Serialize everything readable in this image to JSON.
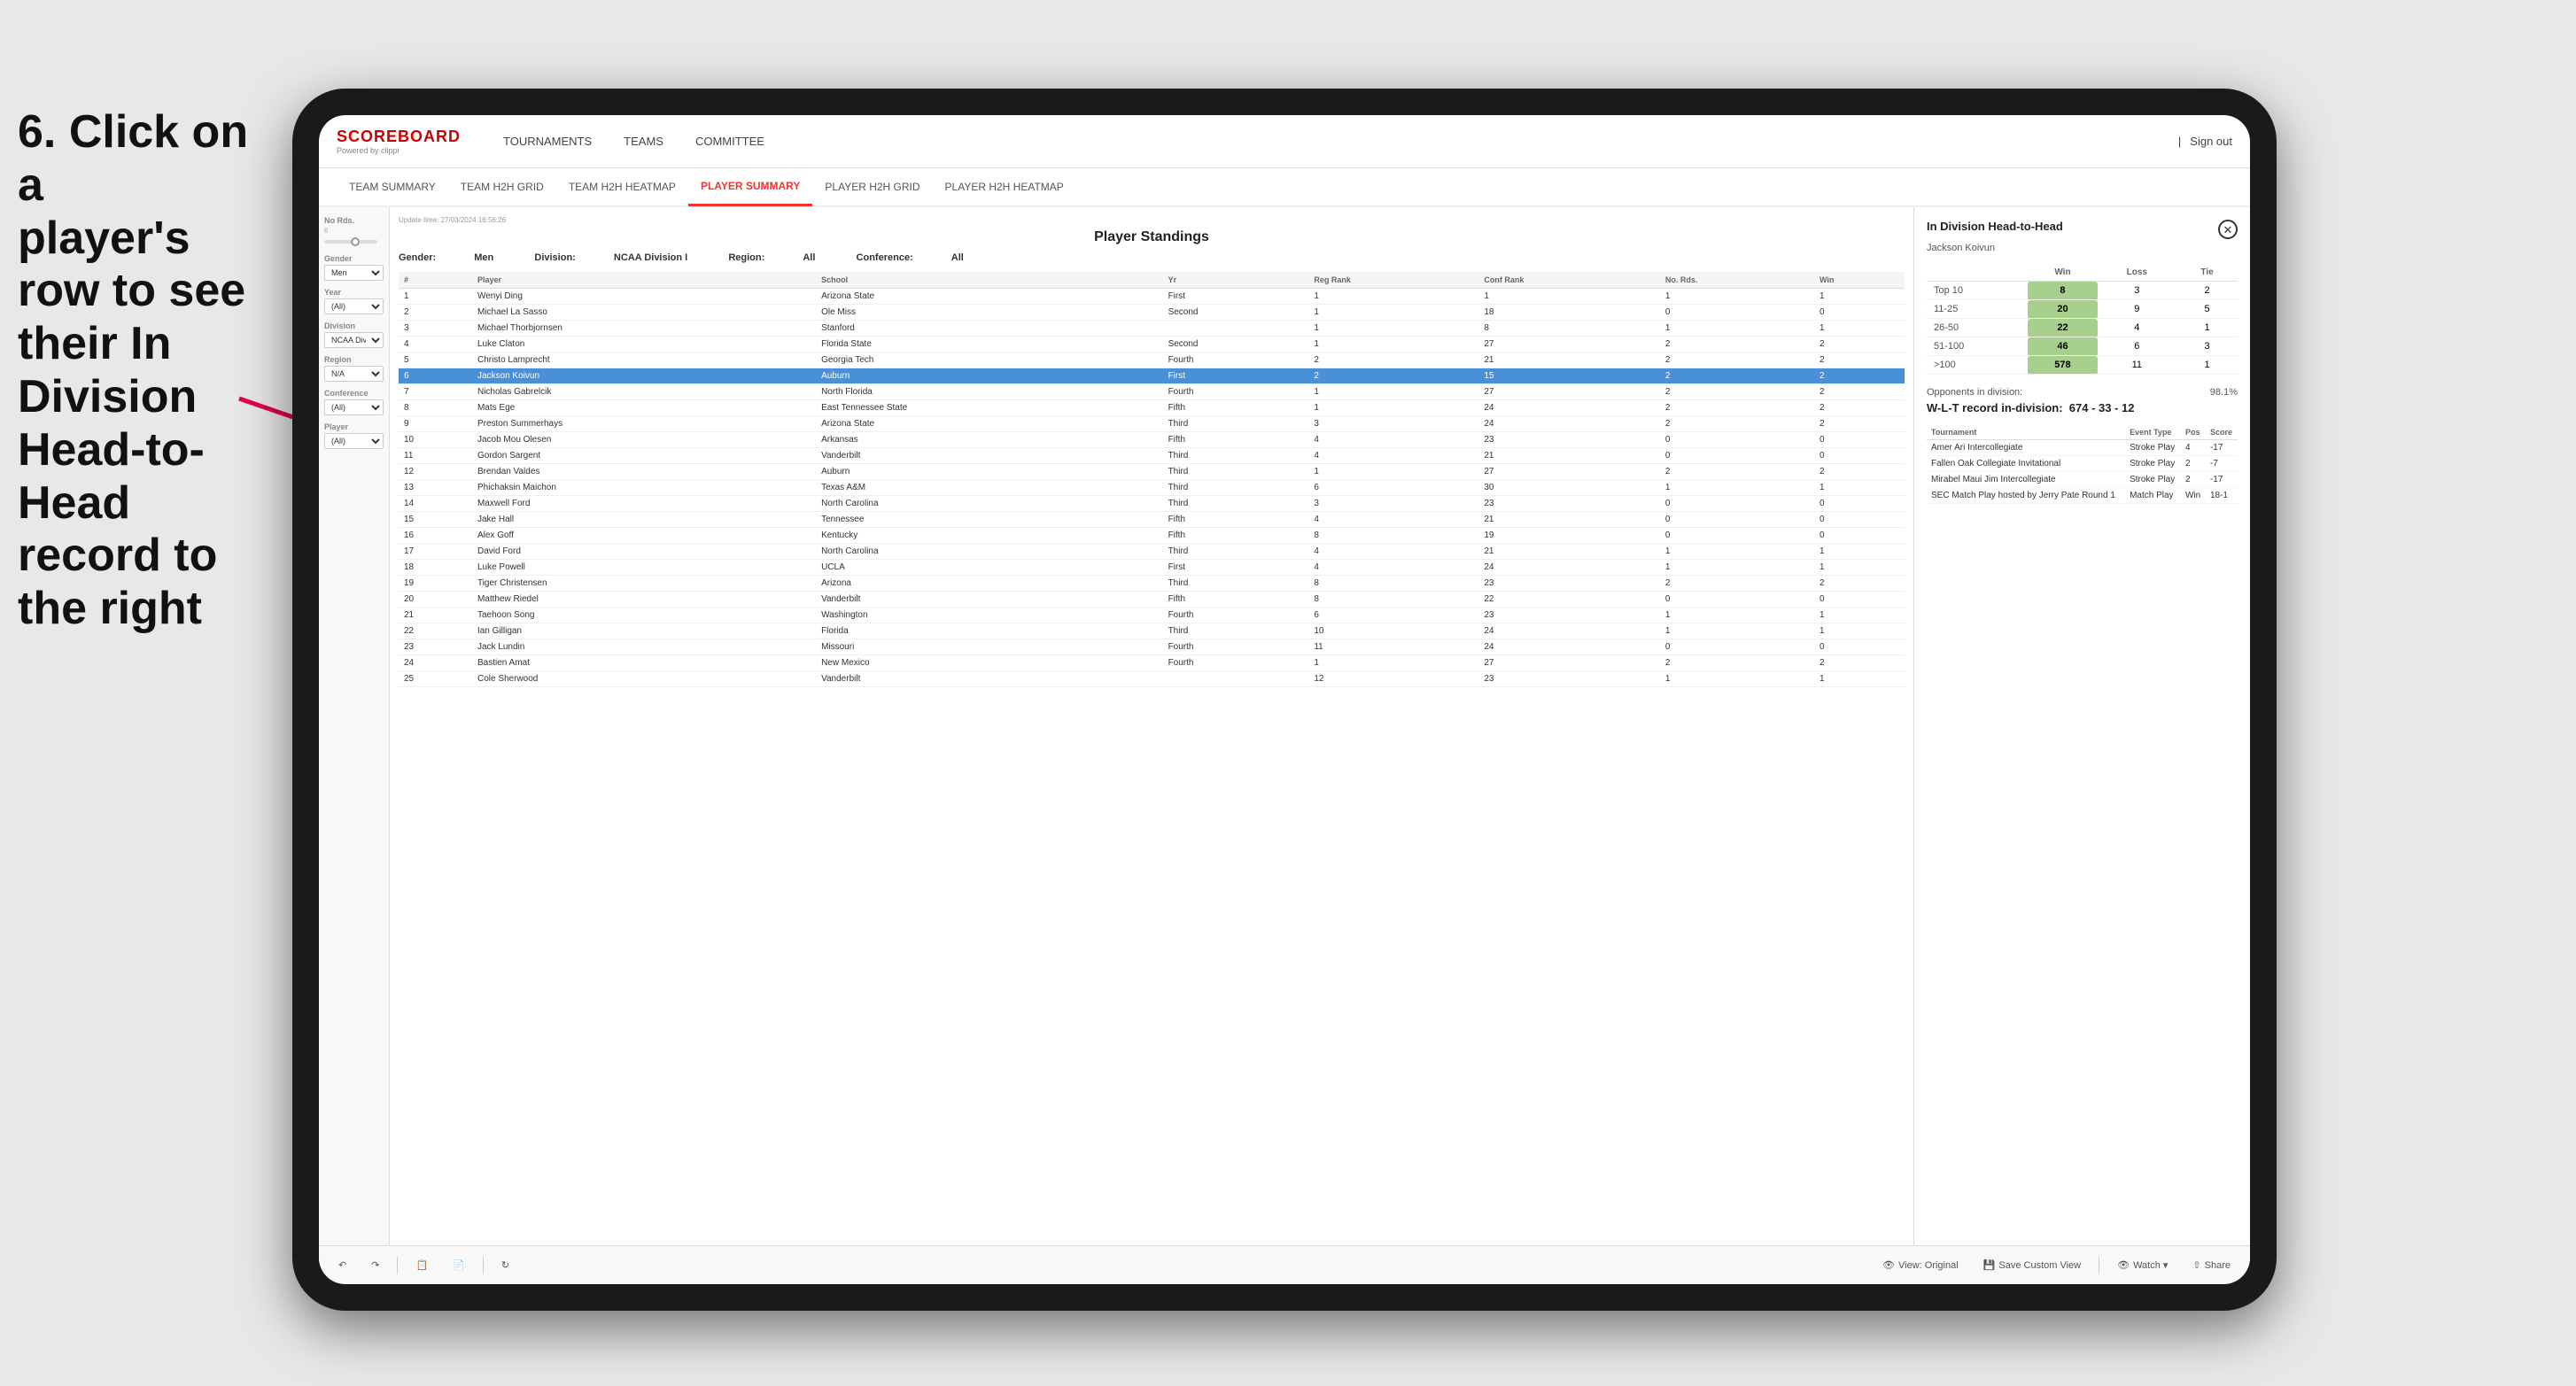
{
  "instruction": {
    "line1": "6. Click on a",
    "line2": "player's row to see",
    "line3": "their In Division",
    "line4": "Head-to-Head",
    "line5": "record to the right"
  },
  "nav": {
    "logo": "SCOREBOARD",
    "powered_by": "Powered by clippi",
    "items": [
      "TOURNAMENTS",
      "TEAMS",
      "COMMITTEE"
    ],
    "sign_out": "Sign out"
  },
  "sub_nav": {
    "items": [
      "TEAM SUMMARY",
      "TEAM H2H GRID",
      "TEAM H2H HEATMAP",
      "PLAYER SUMMARY",
      "PLAYER H2H GRID",
      "PLAYER H2H HEATMAP"
    ],
    "active": "PLAYER SUMMARY"
  },
  "filters": {
    "no_rds_label": "No Rds.",
    "no_rds_value": "6",
    "gender_label": "Gender",
    "gender_value": "Men",
    "year_label": "Year",
    "year_value": "(All)",
    "division_label": "Division",
    "division_value": "NCAA Division I",
    "region_label": "Region",
    "region_value": "N/A",
    "conference_label": "Conference",
    "conference_value": "(All)",
    "player_label": "Player",
    "player_value": "(All)"
  },
  "standings": {
    "title": "Player Standings",
    "update_time": "Update time: 27/03/2024 16:56:26",
    "gender_label": "Gender:",
    "gender_value": "Men",
    "division_label": "Division:",
    "division_value": "NCAA Division I",
    "region_label": "Region:",
    "region_value": "All",
    "conference_label": "Conference:",
    "conference_value": "All",
    "columns": [
      "#",
      "Player",
      "School",
      "Yr",
      "Reg Rank",
      "Conf Rank",
      "No. Rds.",
      "Win"
    ],
    "rows": [
      {
        "num": 1,
        "player": "Wenyi Ding",
        "school": "Arizona State",
        "yr": "First",
        "reg": 1,
        "conf": 1,
        "rds": 1,
        "win": 1
      },
      {
        "num": 2,
        "player": "Michael La Sasso",
        "school": "Ole Miss",
        "yr": "Second",
        "reg": 1,
        "conf": 18,
        "rds": 0,
        "win": 0
      },
      {
        "num": 3,
        "player": "Michael Thorbjornsen",
        "school": "Stanford",
        "yr": "",
        "reg": 1,
        "conf": 8,
        "rds": 1,
        "win": 1
      },
      {
        "num": 4,
        "player": "Luke Claton",
        "school": "Florida State",
        "yr": "Second",
        "reg": 1,
        "conf": 27,
        "rds": 2,
        "win": 2
      },
      {
        "num": 5,
        "player": "Christo Lamprecht",
        "school": "Georgia Tech",
        "yr": "Fourth",
        "reg": 2,
        "conf": 21,
        "rds": 2,
        "win": 2
      },
      {
        "num": 6,
        "player": "Jackson Koivun",
        "school": "Auburn",
        "yr": "First",
        "reg": 2,
        "conf": 15,
        "rds": 2,
        "win": 2,
        "highlighted": true
      },
      {
        "num": 7,
        "player": "Nicholas Gabrelcik",
        "school": "North Florida",
        "yr": "Fourth",
        "reg": 1,
        "conf": 27,
        "rds": 2,
        "win": 2
      },
      {
        "num": 8,
        "player": "Mats Ege",
        "school": "East Tennessee State",
        "yr": "Fifth",
        "reg": 1,
        "conf": 24,
        "rds": 2,
        "win": 2
      },
      {
        "num": 9,
        "player": "Preston Summerhays",
        "school": "Arizona State",
        "yr": "Third",
        "reg": 3,
        "conf": 24,
        "rds": 2,
        "win": 2
      },
      {
        "num": 10,
        "player": "Jacob Mou Olesen",
        "school": "Arkansas",
        "yr": "Fifth",
        "reg": 4,
        "conf": 23,
        "rds": 0,
        "win": 0
      },
      {
        "num": 11,
        "player": "Gordon Sargent",
        "school": "Vanderbilt",
        "yr": "Third",
        "reg": 4,
        "conf": 21,
        "rds": 0,
        "win": 0
      },
      {
        "num": 12,
        "player": "Brendan Valdes",
        "school": "Auburn",
        "yr": "Third",
        "reg": 1,
        "conf": 27,
        "rds": 2,
        "win": 2
      },
      {
        "num": 13,
        "player": "Phichaksin Maichon",
        "school": "Texas A&M",
        "yr": "Third",
        "reg": 6,
        "conf": 30,
        "rds": 1,
        "win": 1
      },
      {
        "num": 14,
        "player": "Maxwell Ford",
        "school": "North Carolina",
        "yr": "Third",
        "reg": 3,
        "conf": 23,
        "rds": 0,
        "win": 0
      },
      {
        "num": 15,
        "player": "Jake Hall",
        "school": "Tennessee",
        "yr": "Fifth",
        "reg": 4,
        "conf": 21,
        "rds": 0,
        "win": 0
      },
      {
        "num": 16,
        "player": "Alex Goff",
        "school": "Kentucky",
        "yr": "Fifth",
        "reg": 8,
        "conf": 19,
        "rds": 0,
        "win": 0
      },
      {
        "num": 17,
        "player": "David Ford",
        "school": "North Carolina",
        "yr": "Third",
        "reg": 4,
        "conf": 21,
        "rds": 1,
        "win": 1
      },
      {
        "num": 18,
        "player": "Luke Powell",
        "school": "UCLA",
        "yr": "First",
        "reg": 4,
        "conf": 24,
        "rds": 1,
        "win": 1
      },
      {
        "num": 19,
        "player": "Tiger Christensen",
        "school": "Arizona",
        "yr": "Third",
        "reg": 8,
        "conf": 23,
        "rds": 2,
        "win": 2
      },
      {
        "num": 20,
        "player": "Matthew Riedel",
        "school": "Vanderbilt",
        "yr": "Fifth",
        "reg": 8,
        "conf": 22,
        "rds": 0,
        "win": 0
      },
      {
        "num": 21,
        "player": "Taehoon Song",
        "school": "Washington",
        "yr": "Fourth",
        "reg": 6,
        "conf": 23,
        "rds": 1,
        "win": 1
      },
      {
        "num": 22,
        "player": "Ian Gilligan",
        "school": "Florida",
        "yr": "Third",
        "reg": 10,
        "conf": 24,
        "rds": 1,
        "win": 1
      },
      {
        "num": 23,
        "player": "Jack Lundin",
        "school": "Missouri",
        "yr": "Fourth",
        "reg": 11,
        "conf": 24,
        "rds": 0,
        "win": 0
      },
      {
        "num": 24,
        "player": "Bastien Amat",
        "school": "New Mexico",
        "yr": "Fourth",
        "reg": 1,
        "conf": 27,
        "rds": 2,
        "win": 2
      },
      {
        "num": 25,
        "player": "Cole Sherwood",
        "school": "Vanderbilt",
        "yr": "",
        "reg": 12,
        "conf": 23,
        "rds": 1,
        "win": 1
      }
    ]
  },
  "h2h": {
    "title": "In Division Head-to-Head",
    "player": "Jackson Koivun",
    "table_headers": [
      "",
      "Win",
      "Loss",
      "Tie"
    ],
    "rows": [
      {
        "label": "Top 10",
        "win": 8,
        "loss": 3,
        "tie": 2,
        "win_green": true
      },
      {
        "label": "11-25",
        "win": 20,
        "loss": 9,
        "tie": 5,
        "win_green": true
      },
      {
        "label": "26-50",
        "win": 22,
        "loss": 4,
        "tie": 1,
        "win_green": true
      },
      {
        "label": "51-100",
        "win": 46,
        "loss": 6,
        "tie": 3,
        "win_green": true
      },
      {
        "label": ">100",
        "win": 578,
        "loss": 11,
        "tie": 1,
        "win_green": true
      }
    ],
    "opponents_label": "Opponents in division:",
    "opponents_value": "98.1%",
    "wlt_label": "W-L-T record in-division:",
    "wlt_value": "674 - 33 - 12",
    "tournament_headers": [
      "Tournament",
      "Event Type",
      "Pos",
      "Score"
    ],
    "tournaments": [
      {
        "name": "Amer Ari Intercollegiate",
        "type": "Stroke Play",
        "pos": 4,
        "score": "-17"
      },
      {
        "name": "Fallen Oak Collegiate Invitational",
        "type": "Stroke Play",
        "pos": 2,
        "score": "-7"
      },
      {
        "name": "Mirabel Maui Jim Intercollegiate",
        "type": "Stroke Play",
        "pos": 2,
        "score": "-17"
      },
      {
        "name": "SEC Match Play hosted by Jerry Pate Round 1",
        "type": "Match Play",
        "pos": "Win",
        "score": "18-1"
      }
    ]
  },
  "toolbar": {
    "view_original": "View: Original",
    "save_custom": "Save Custom View",
    "watch": "Watch ▾",
    "share": "Share"
  }
}
